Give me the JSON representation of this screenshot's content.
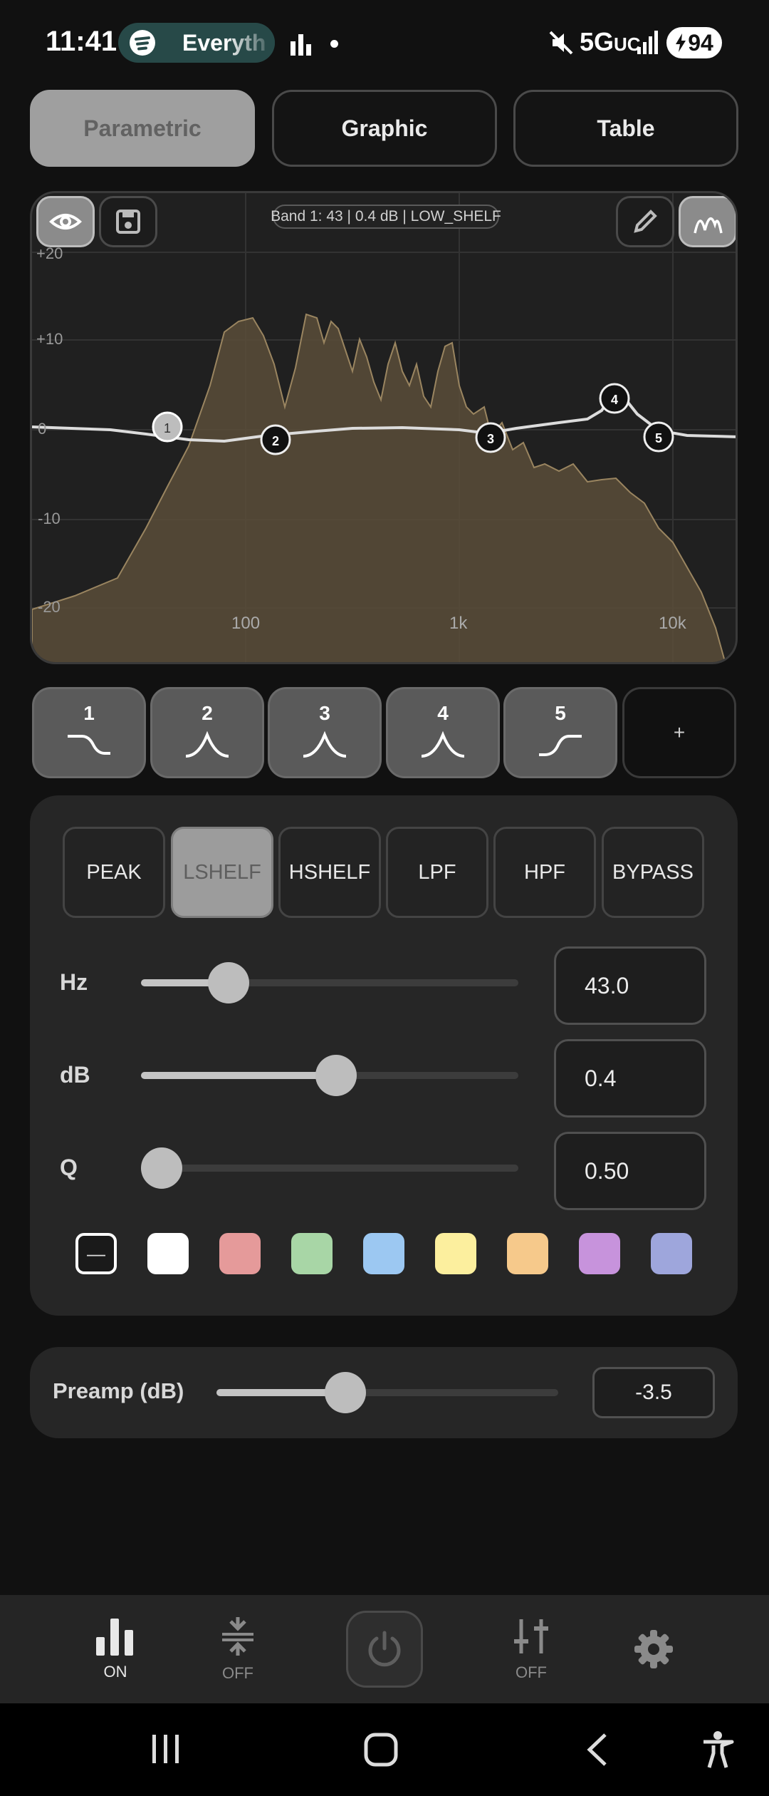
{
  "status_bar": {
    "time": "11:41",
    "media_app": "Everyth",
    "network": "5G",
    "network_suffix": "UC",
    "battery": "94"
  },
  "top_tabs": [
    {
      "label": "Parametric",
      "active": true
    },
    {
      "label": "Graphic",
      "active": false
    },
    {
      "label": "Table",
      "active": false
    }
  ],
  "graph": {
    "band_info": "Band 1: 43 | 0.4 dB | LOW_SHELF",
    "y_labels": [
      "+20",
      "+10",
      "0",
      "-10",
      "-20"
    ],
    "x_labels": [
      "100",
      "1k",
      "10k"
    ],
    "band_nodes": [
      "1",
      "2",
      "3",
      "4",
      "5"
    ]
  },
  "bands": [
    {
      "number": "1",
      "shape": "low-shelf-icon"
    },
    {
      "number": "2",
      "shape": "peak-icon"
    },
    {
      "number": "3",
      "shape": "peak-icon"
    },
    {
      "number": "4",
      "shape": "peak-icon"
    },
    {
      "number": "5",
      "shape": "high-shelf-icon"
    },
    {
      "number": "+",
      "shape": "add"
    }
  ],
  "filter_types": [
    {
      "label": "PEAK",
      "active": false
    },
    {
      "label": "LSHELF",
      "active": true
    },
    {
      "label": "HSHELF",
      "active": false
    },
    {
      "label": "LPF",
      "active": false
    },
    {
      "label": "HPF",
      "active": false
    },
    {
      "label": "BYPASS",
      "active": false
    }
  ],
  "params": {
    "hz": {
      "label": "Hz",
      "value": "43.0",
      "slider_fraction": 0.2
    },
    "db": {
      "label": "dB",
      "value": "0.4",
      "slider_fraction": 0.52
    },
    "q": {
      "label": "Q",
      "value": "0.50",
      "slider_fraction": 0.0
    }
  },
  "swatch_colors": [
    "none",
    "#ffffff",
    "#e59a9a",
    "#a8d6a6",
    "#9cc8f2",
    "#fcef9e",
    "#f6c98b",
    "#c793dc",
    "#9ea6dc"
  ],
  "swatch_none_glyph": "—",
  "preamp": {
    "label": "Preamp (dB)",
    "value": "-3.5",
    "slider_fraction": 0.36
  },
  "bottom_nav": [
    {
      "icon": "equalizer-bars-icon",
      "label": "ON"
    },
    {
      "icon": "compress-icon",
      "label": "OFF"
    },
    {
      "icon": "power-icon",
      "label": ""
    },
    {
      "icon": "sliders-icon",
      "label": "OFF"
    },
    {
      "icon": "gear-icon",
      "label": ""
    }
  ],
  "colors": {
    "accent": "#9c9c9c",
    "background": "#111111",
    "panel": "#262626"
  }
}
